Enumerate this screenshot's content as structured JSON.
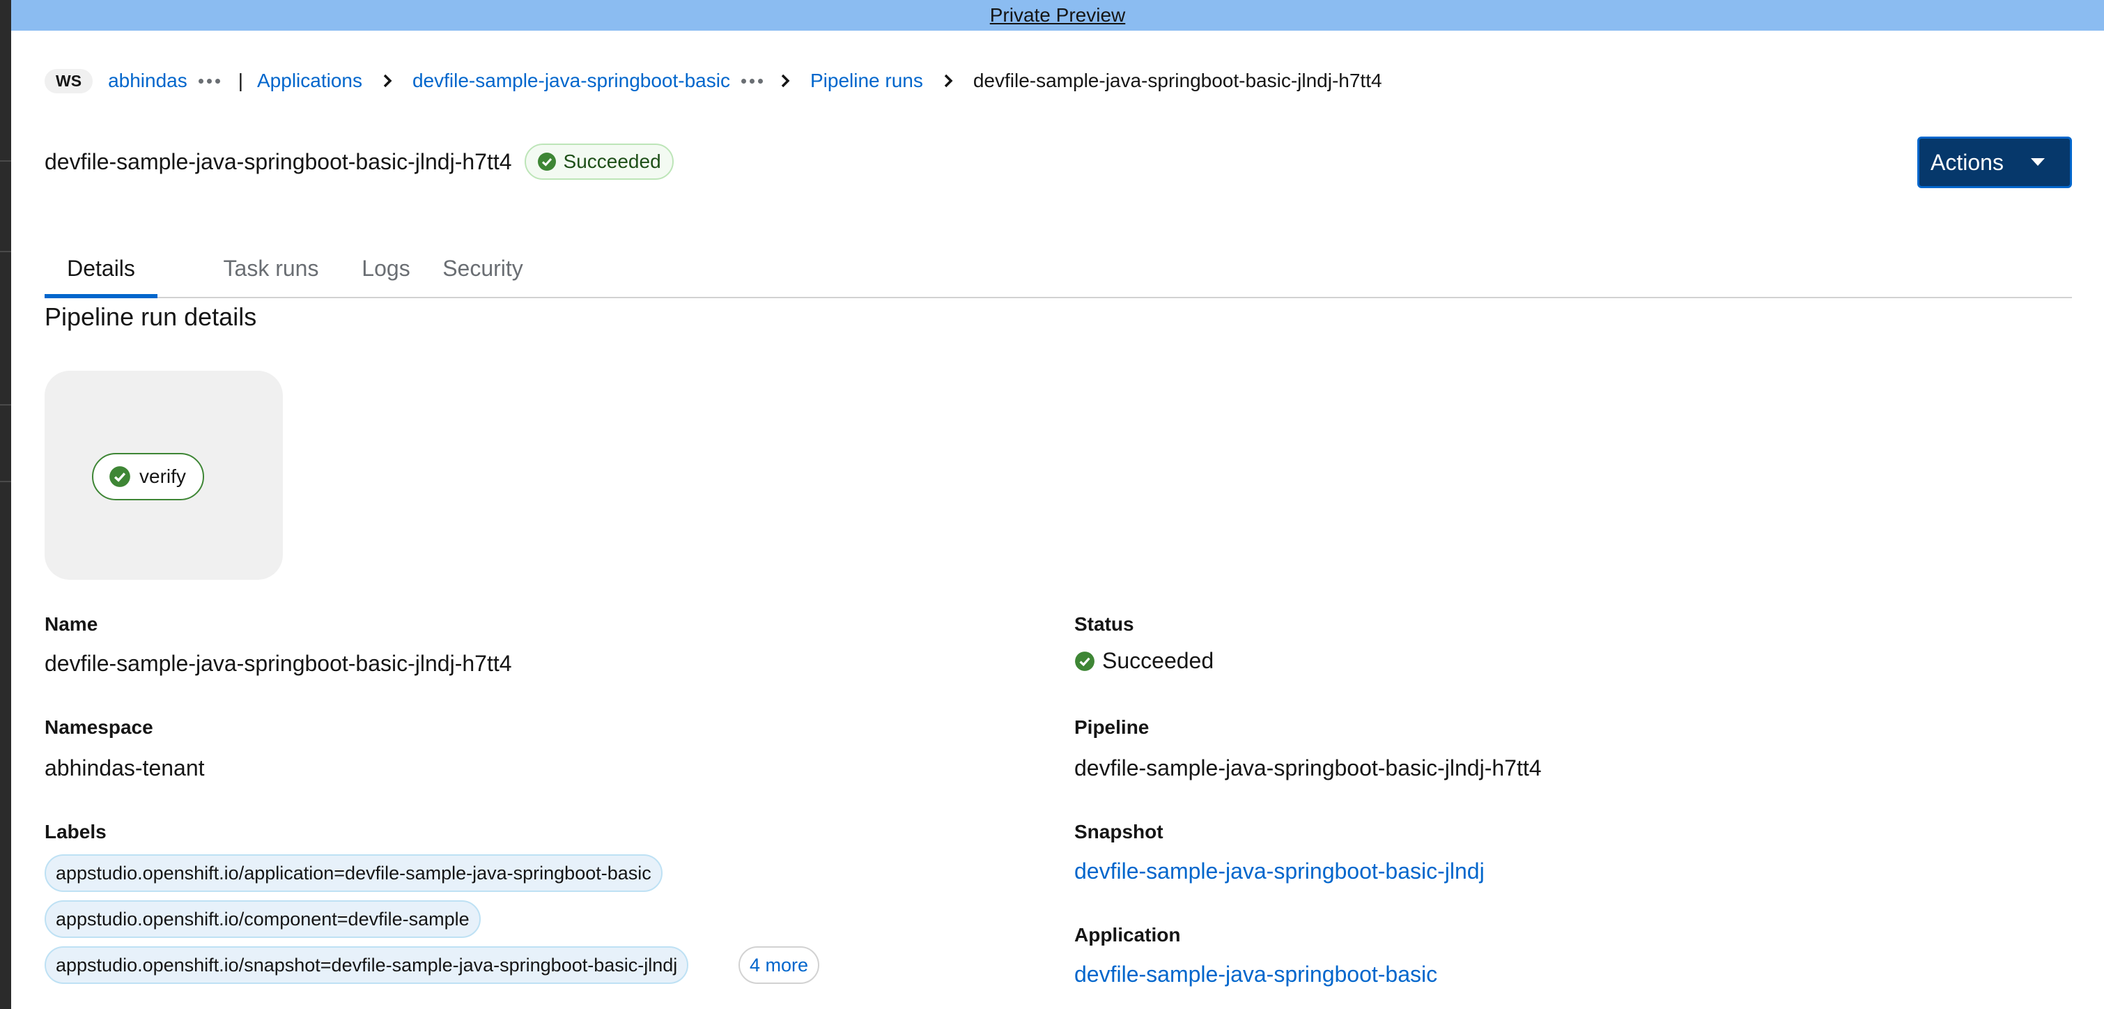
{
  "banner": {
    "text": "Private Preview"
  },
  "breadcrumb": {
    "workspace_badge": "WS",
    "workspace": "abhindas",
    "pipe": "|",
    "applications": "Applications",
    "application": "devfile-sample-java-springboot-basic",
    "pipeline_runs": "Pipeline runs",
    "current": "devfile-sample-java-springboot-basic-jlndj-h7tt4"
  },
  "header": {
    "title": "devfile-sample-java-springboot-basic-jlndj-h7tt4",
    "status": "Succeeded",
    "actions_label": "Actions"
  },
  "tabs": [
    {
      "label": "Details",
      "active": true
    },
    {
      "label": "Task runs",
      "active": false
    },
    {
      "label": "Logs",
      "active": false
    },
    {
      "label": "Security",
      "active": false
    }
  ],
  "section_title": "Pipeline run details",
  "graph": {
    "task": "verify",
    "task_status_icon": "check-circle-icon"
  },
  "details": {
    "name_label": "Name",
    "name_value": "devfile-sample-java-springboot-basic-jlndj-h7tt4",
    "namespace_label": "Namespace",
    "namespace_value": "abhindas-tenant",
    "labels_label": "Labels",
    "labels": [
      "appstudio.openshift.io/application=devfile-sample-java-springboot-basic",
      "appstudio.openshift.io/component=devfile-sample",
      "appstudio.openshift.io/snapshot=devfile-sample-java-springboot-basic-jlndj"
    ],
    "labels_more": "4 more",
    "status_label": "Status",
    "status_value": "Succeeded",
    "pipeline_label": "Pipeline",
    "pipeline_value": "devfile-sample-java-springboot-basic-jlndj-h7tt4",
    "snapshot_label": "Snapshot",
    "snapshot_value": "devfile-sample-java-springboot-basic-jlndj",
    "application_label": "Application",
    "application_value": "devfile-sample-java-springboot-basic"
  },
  "colors": {
    "banner": "#8bbcf1",
    "link": "#0066cc",
    "success": "#3e8635",
    "primary_button": "#06386b"
  }
}
